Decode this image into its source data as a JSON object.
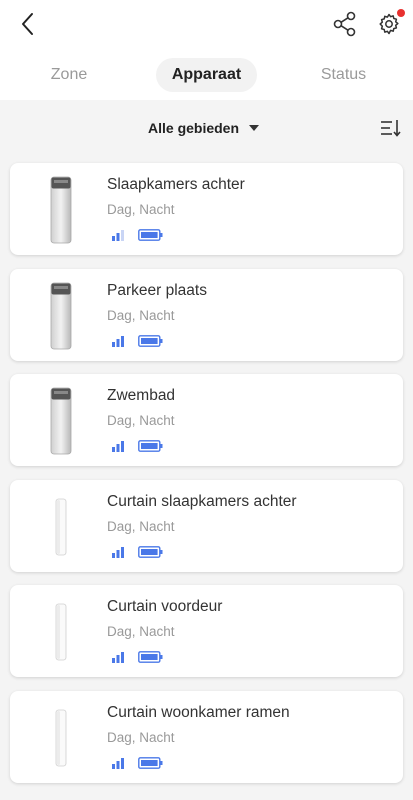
{
  "header": {
    "back_icon": "chevron-left-icon",
    "share_icon": "share-icon",
    "settings_icon": "gear-icon",
    "notification_color": "#e8312f"
  },
  "tabs": [
    {
      "label": "Zone",
      "active": false
    },
    {
      "label": "Apparaat",
      "active": true
    },
    {
      "label": "Status",
      "active": false
    }
  ],
  "filter": {
    "label": "Alle gebieden",
    "sort_icon": "sort-icon"
  },
  "accent_color": "#4a78e8",
  "devices": [
    {
      "name": "Slaapkamers achter",
      "mode": "Dag, Nacht",
      "type": "pir-camera",
      "signal_bars": 2
    },
    {
      "name": "Parkeer plaats",
      "mode": "Dag, Nacht",
      "type": "pir-camera",
      "signal_bars": 3
    },
    {
      "name": "Zwembad",
      "mode": "Dag, Nacht",
      "type": "pir-camera",
      "signal_bars": 3
    },
    {
      "name": "Curtain slaapkamers achter",
      "mode": "Dag, Nacht",
      "type": "curtain-detector",
      "signal_bars": 3
    },
    {
      "name": "Curtain voordeur",
      "mode": "Dag, Nacht",
      "type": "curtain-detector",
      "signal_bars": 3
    },
    {
      "name": "Curtain woonkamer ramen",
      "mode": "Dag, Nacht",
      "type": "curtain-detector",
      "signal_bars": 3
    }
  ]
}
